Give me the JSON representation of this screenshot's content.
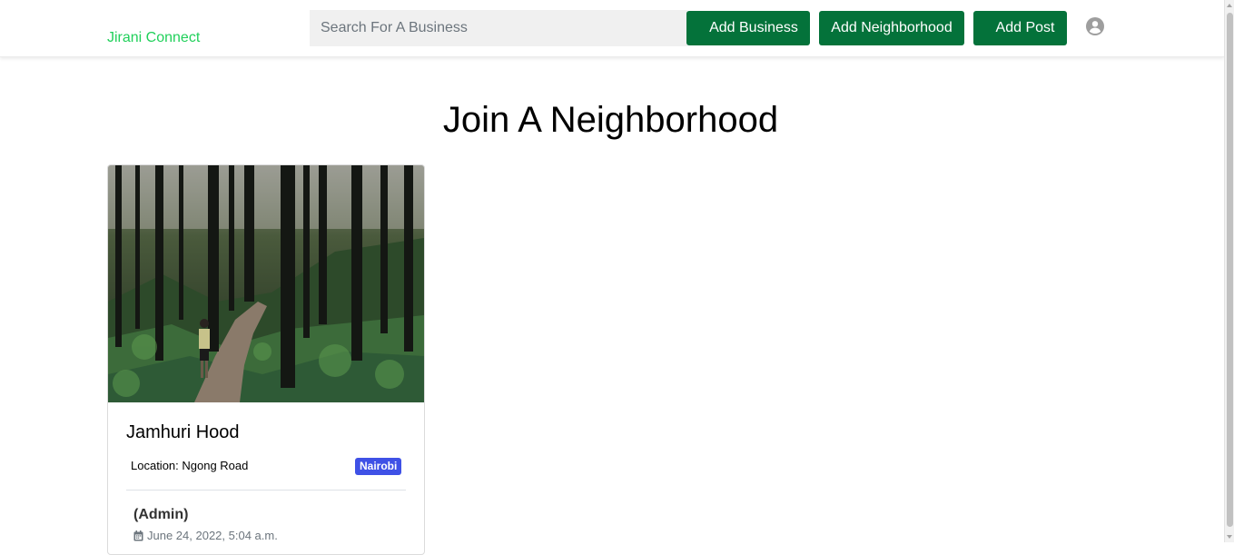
{
  "navbar": {
    "brand": "Jirani Connect",
    "search_placeholder": "Search For A Business",
    "buttons": {
      "add_business": "Add Business",
      "add_neighborhood": "Add Neighborhood",
      "add_post": "Add Post"
    },
    "user_icon": "user-circle-icon"
  },
  "main": {
    "title": "Join A Neighborhood",
    "neighborhoods": [
      {
        "name": "Jamhuri Hood",
        "location_label": "Location: Ngong Road",
        "city_badge": "Nairobi",
        "admin_label": "(Admin)",
        "date": "June 24, 2022, 5:04 a.m.",
        "image": "forest-trail-photo"
      }
    ]
  },
  "colors": {
    "brand": "#20d05a",
    "button": "#04723a",
    "badge": "#3f51e6"
  }
}
